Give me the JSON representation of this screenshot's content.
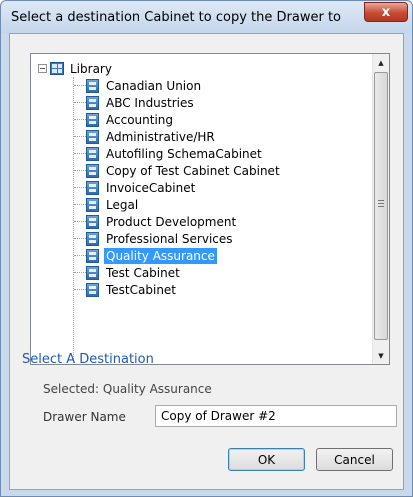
{
  "window": {
    "title": "Select a destination Cabinet to copy the Drawer to",
    "close_glyph": "x"
  },
  "tree": {
    "root": {
      "label": "Library",
      "icon": "library-icon",
      "expander": "−"
    },
    "items": [
      {
        "label": "Canadian Union",
        "icon": "cabinet-icon"
      },
      {
        "label": "ABC Industries",
        "icon": "cabinet-icon"
      },
      {
        "label": "Accounting",
        "icon": "cabinet-icon"
      },
      {
        "label": "Administrative/HR",
        "icon": "cabinet-icon"
      },
      {
        "label": "Autofiling SchemaCabinet",
        "icon": "cabinet-icon"
      },
      {
        "label": "Copy of Test Cabinet Cabinet",
        "icon": "cabinet-icon"
      },
      {
        "label": "InvoiceCabinet",
        "icon": "cabinet-icon"
      },
      {
        "label": "Legal",
        "icon": "cabinet-icon"
      },
      {
        "label": "Product Development",
        "icon": "cabinet-icon"
      },
      {
        "label": "Professional Services",
        "icon": "cabinet-icon"
      },
      {
        "label": "Quality Assurance",
        "icon": "cabinet-icon",
        "selected": true
      },
      {
        "label": "Test Cabinet",
        "icon": "cabinet-icon"
      },
      {
        "label": "TestCabinet",
        "icon": "cabinet-icon"
      }
    ],
    "selection_color": "#3399ff"
  },
  "destination": {
    "heading": "Select A Destination",
    "selected_text": "Selected: Quality Assurance",
    "drawer_name_label": "Drawer Name",
    "drawer_name_value": "Copy of Drawer #2"
  },
  "buttons": {
    "ok": "OK",
    "cancel": "Cancel"
  }
}
